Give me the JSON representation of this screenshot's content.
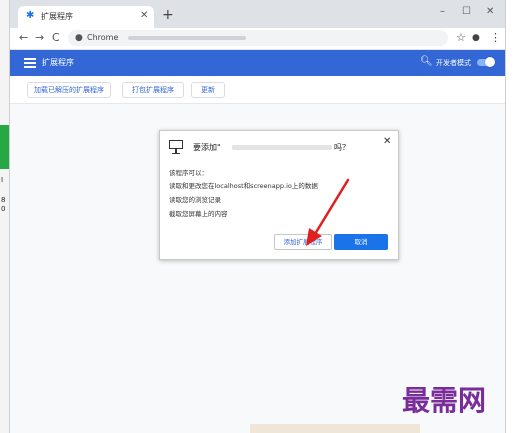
{
  "left_strip": {
    "fragments": [
      "I",
      "8",
      "0"
    ]
  },
  "tab": {
    "title": "扩展程序",
    "icon": "puzzle-icon"
  },
  "window_controls": {
    "minimize": "–",
    "maximize": "☐",
    "close": "✕"
  },
  "toolbar": {
    "back": "←",
    "forward": "→",
    "reload": "C",
    "omnibox_label": "Chrome",
    "star": "☆",
    "profile": "👤",
    "menu": "⋮"
  },
  "appbar": {
    "title": "扩展程序",
    "dev_mode_label": "开发者模式",
    "dev_mode_on": true,
    "color": "#3367d6"
  },
  "actions": {
    "load_unpacked": "加载已解压的扩展程序",
    "pack": "打包扩展程序",
    "update": "更新"
  },
  "dialog": {
    "title_prefix": "要添加\"",
    "title_suffix": "吗？",
    "close": "✕",
    "intro": "该程序可以：",
    "permissions": [
      "读取和更改您在localhost和screenapp.io上的数据",
      "读取您的浏览记录",
      "截取您屏幕上的内容"
    ],
    "add_button": "添加扩展程序",
    "cancel_button": "取消",
    "accent": "#1a73e8"
  },
  "watermark": "最需网"
}
